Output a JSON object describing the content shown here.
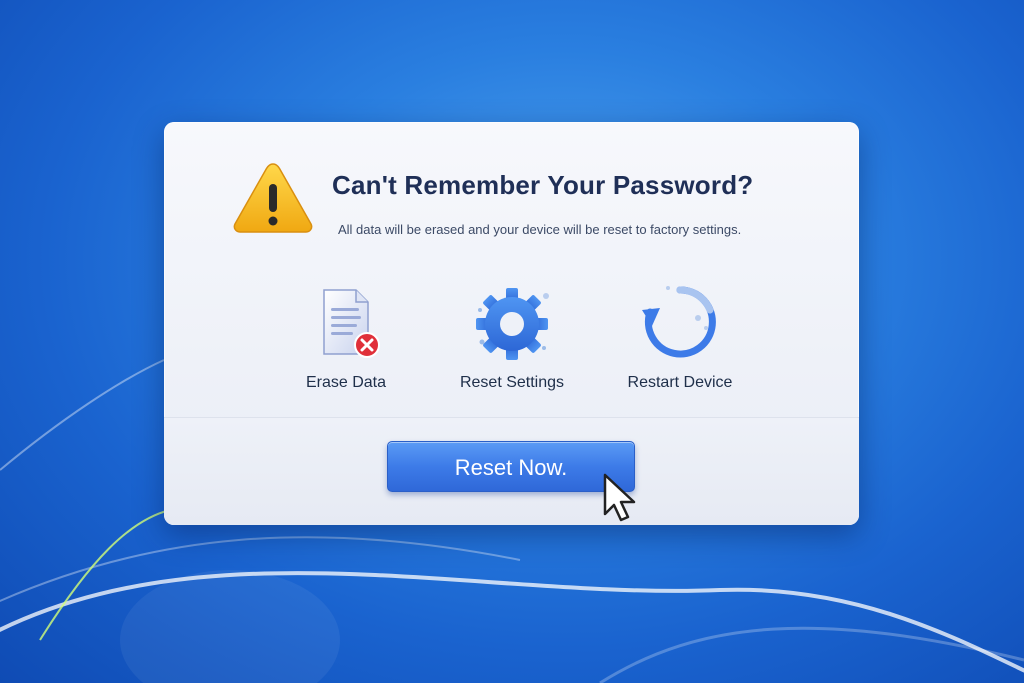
{
  "dialog": {
    "title": "Can't Remember Your Password?",
    "subtitle": "All data will be erased and your device will be reset to factory settings.",
    "warning_icon": "warning-triangle-icon"
  },
  "options": [
    {
      "label": "Erase Data",
      "icon": "erase-document-icon"
    },
    {
      "label": "Reset Settings",
      "icon": "gear-icon"
    },
    {
      "label": "Restart Device",
      "icon": "restart-arrows-icon"
    }
  ],
  "actions": {
    "reset_label": "Reset Now."
  },
  "colors": {
    "accent": "#3d7be8",
    "title": "#1f2f57",
    "warning": "#f5b820",
    "error": "#e0303a",
    "desktop": "#1a63cf"
  },
  "pointer": {
    "icon": "mouse-pointer-icon"
  }
}
